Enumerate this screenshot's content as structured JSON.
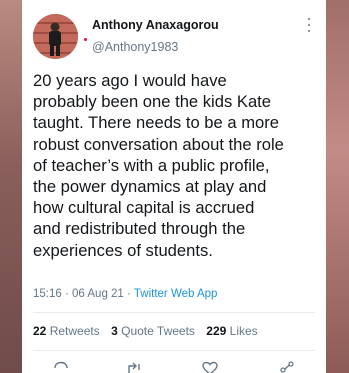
{
  "author": {
    "name": "Anthony Anaxagorou",
    "handle": "@Anthony1983"
  },
  "tweet": {
    "lines": [
      "20 years ago I would have",
      "probably been one the kids Kate",
      "taught. There needs to be a more",
      "robust conversation about the role",
      "of teacher’s with a public profile,",
      "the power dynamics at play and",
      "how cultural capital is accrued",
      "and redistributed through the",
      "experiences of students."
    ]
  },
  "meta": {
    "time": "15:16",
    "separator": "·",
    "date": "06 Aug 21",
    "source": "Twitter Web App"
  },
  "stats": {
    "retweets_count": "22",
    "retweets_label": "Retweets",
    "quotes_count": "3",
    "quotes_label": "Quote Tweets",
    "likes_count": "229",
    "likes_label": "Likes"
  },
  "icons": {
    "avatar": "avatar-photo",
    "more": "more-vertical-icon",
    "reply": "reply-icon",
    "retweet": "retweet-icon",
    "like": "heart-icon",
    "share": "share-icon"
  },
  "colors": {
    "text": "#14171a",
    "secondary": "#657786",
    "link": "#1b95e0",
    "divider": "#e6ecf0"
  }
}
